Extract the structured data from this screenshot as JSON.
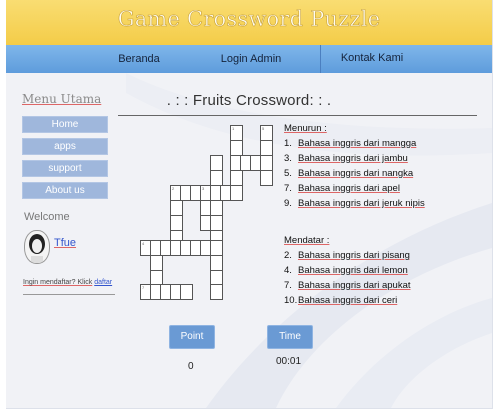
{
  "banner": {
    "title": "Game Crossword Puzzle",
    "color": "#f6d35a"
  },
  "nav": {
    "items": [
      "Beranda",
      "Login Admin",
      "Kontak Kami"
    ],
    "color": "#6aa6e2"
  },
  "sidebar": {
    "title": "Menu Utama",
    "menu": [
      "Home",
      "apps",
      "support",
      "About us"
    ],
    "welcome": "Welcome",
    "user": "Tfue",
    "register_prompt": "Ingin mendaftar? Klick",
    "register_link": "daftar"
  },
  "main": {
    "heading": ". : : Fruits Crossword: : .",
    "down": {
      "title": "Menurun :",
      "clues": [
        {
          "num": "1.",
          "text": "Bahasa inggris dari mangga"
        },
        {
          "num": "3.",
          "text": "Bahasa inggris dari jambu"
        },
        {
          "num": "5.",
          "text": "Bahasa inggris dari nangka"
        },
        {
          "num": "7.",
          "text": "Bahasa inggris dari apel"
        },
        {
          "num": "9.",
          "text": "Bahasa inggris dari jeruk nipis"
        }
      ]
    },
    "across": {
      "title": "Mendatar :",
      "clues": [
        {
          "num": "2.",
          "text": "Bahasa inggris dari pisang"
        },
        {
          "num": "4.",
          "text": "Bahasa inggris dari lemon"
        },
        {
          "num": "7.",
          "text": "Bahasa inggris dari apukat"
        },
        {
          "num": "10.",
          "text": "Bahasa inggris dari ceri"
        }
      ]
    },
    "point_label": "Point",
    "point_value": "0",
    "time_label": "Time",
    "time_value": "00:01"
  }
}
